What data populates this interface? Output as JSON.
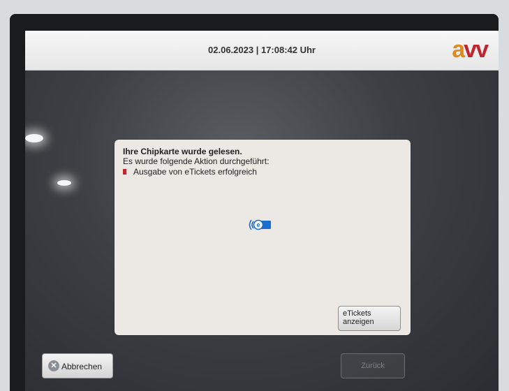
{
  "header": {
    "datetime": "02.06.2023 | 17:08:42 Uhr",
    "logo_a": "a",
    "logo_vv": "vv"
  },
  "dialog": {
    "title": "Ihre Chipkarte wurde gelesen.",
    "line": "Es wurde folgende Aktion durchgeführt:",
    "item": "Ausgabe von eTickets erfolgreich",
    "chip_icon": "e-chipcard-icon",
    "etickets_button_line1": "eTickets",
    "etickets_button_line2": "anzeigen"
  },
  "footer": {
    "abbrechen_label": "Abbrechen",
    "zurueck_label": "Zurück"
  },
  "colors": {
    "logo_a": "#e08a1e",
    "logo_vv": "#c0262d",
    "bullet": "#c0262d",
    "chip_blue": "#1c6fd1"
  }
}
